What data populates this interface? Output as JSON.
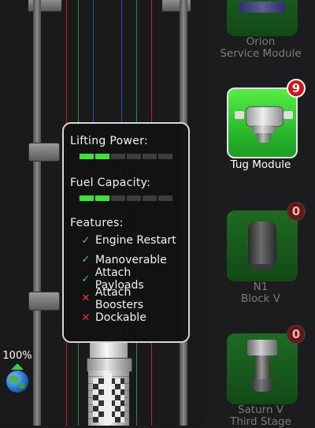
{
  "launch": {
    "percent": "100%"
  },
  "tooltip": {
    "lifting_power_label": "Lifting Power:",
    "lifting_power_level": 2,
    "fuel_capacity_label": "Fuel Capacity:",
    "fuel_capacity_level": 2,
    "meter_segments": 6,
    "features_label": "Features:",
    "features": [
      {
        "label": "Engine Restart",
        "enabled": true
      },
      {
        "label": "Manoverable",
        "enabled": true
      },
      {
        "label": "Attach Payloads",
        "enabled": true
      },
      {
        "label": "Attach Boosters",
        "enabled": false
      },
      {
        "label": "Dockable",
        "enabled": false
      }
    ]
  },
  "modules": [
    {
      "label_line1": "Orion",
      "label_line2": "Service Module",
      "count": null,
      "selected": false
    },
    {
      "label_line1": "Tug Module",
      "label_line2": "",
      "count": "9",
      "selected": true
    },
    {
      "label_line1": "N1",
      "label_line2": "Block V",
      "count": "0",
      "selected": false
    },
    {
      "label_line1": "Saturn V",
      "label_line2": "Third Stage",
      "count": "0",
      "selected": false
    }
  ],
  "colors": {
    "meter_on": "#39e62e",
    "meter_off": "#3d3d3d",
    "check": "#36d43b",
    "cross": "#ff2b2b",
    "badge_red": "#d41414"
  }
}
